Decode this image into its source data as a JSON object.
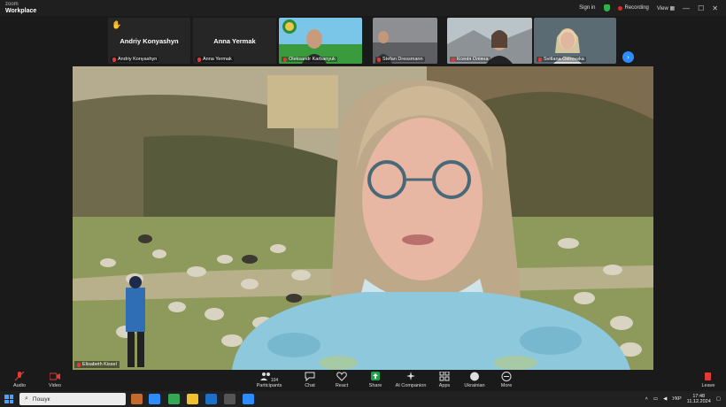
{
  "app": {
    "brand_top": "zoom",
    "brand_bottom": "Workplace"
  },
  "titlebar": {
    "sign_in": "Sign in",
    "recording": "Recording",
    "view": "View"
  },
  "participants_strip": [
    {
      "name": "Andriy Konyashyn",
      "label": "Andriy Konyashyn",
      "video": false,
      "hand": true
    },
    {
      "name": "Anna Yermak",
      "label": "Anna Yermak",
      "video": false,
      "hand": false
    },
    {
      "label": "Oleksandr Karbanyuk",
      "video": true
    },
    {
      "label": "Stefan Dressmann",
      "video": true
    },
    {
      "label": "Ксенія Оліяна",
      "video": true
    },
    {
      "label": "Svitlana Ostrovska",
      "video": true
    }
  ],
  "main_video": {
    "speaker": "Elisabeth Kissel"
  },
  "toolbar": {
    "audio": "Audio",
    "video": "Video",
    "participants": "Participants",
    "participants_count": "104",
    "chat": "Chat",
    "react": "React",
    "share": "Share",
    "ai": "AI Companion",
    "apps": "Apps",
    "language": "Ukrainian",
    "more": "More",
    "leave": "Leave"
  },
  "taskbar": {
    "search_placeholder": "Пошук",
    "lang": "УКР",
    "time": "17:48",
    "date": "11.12.2024"
  },
  "colors": {
    "accent": "#2d8cff",
    "record": "#e02a2a",
    "share_green": "#19a54a",
    "leave_red": "#e53935"
  }
}
